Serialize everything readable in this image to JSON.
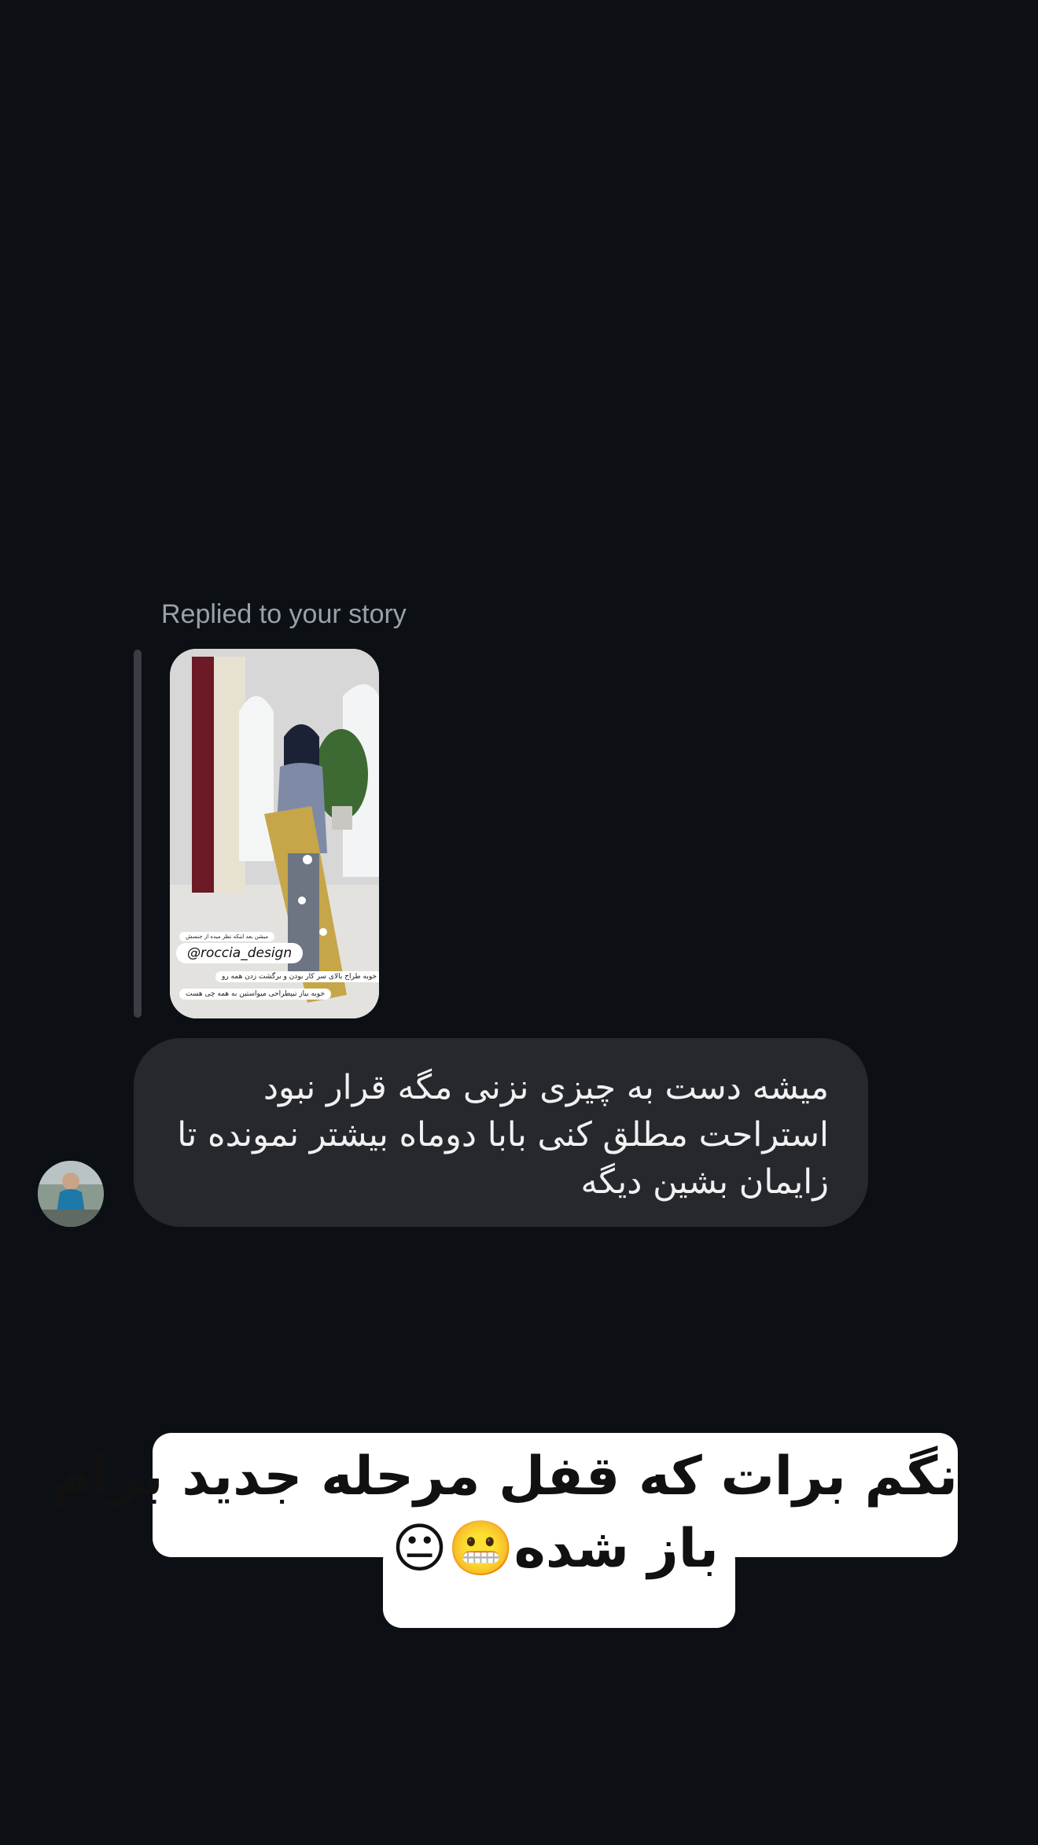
{
  "reply": {
    "label": "Replied to your story"
  },
  "story": {
    "tag": "@roccia_design",
    "captions": [
      "میشن بعد اینکه نظر میده از جنسش",
      "خوبه طراح بالای سر کار بودن و برگشت زدن همه رو",
      "خوبه بیاز تیپطراحی میواستین به همه چی هست"
    ]
  },
  "message": {
    "lines": [
      "میشه دست به چیزی نزنی مگه قرار نبود",
      "استراحت مطلق کنی بابا دوماه بیشتر نمونده تا",
      "زایمان بشین دیگه"
    ]
  },
  "caption": {
    "line1": "نگم برات که قفل مرحله جدید برام",
    "line2": "باز شده😬😐"
  }
}
